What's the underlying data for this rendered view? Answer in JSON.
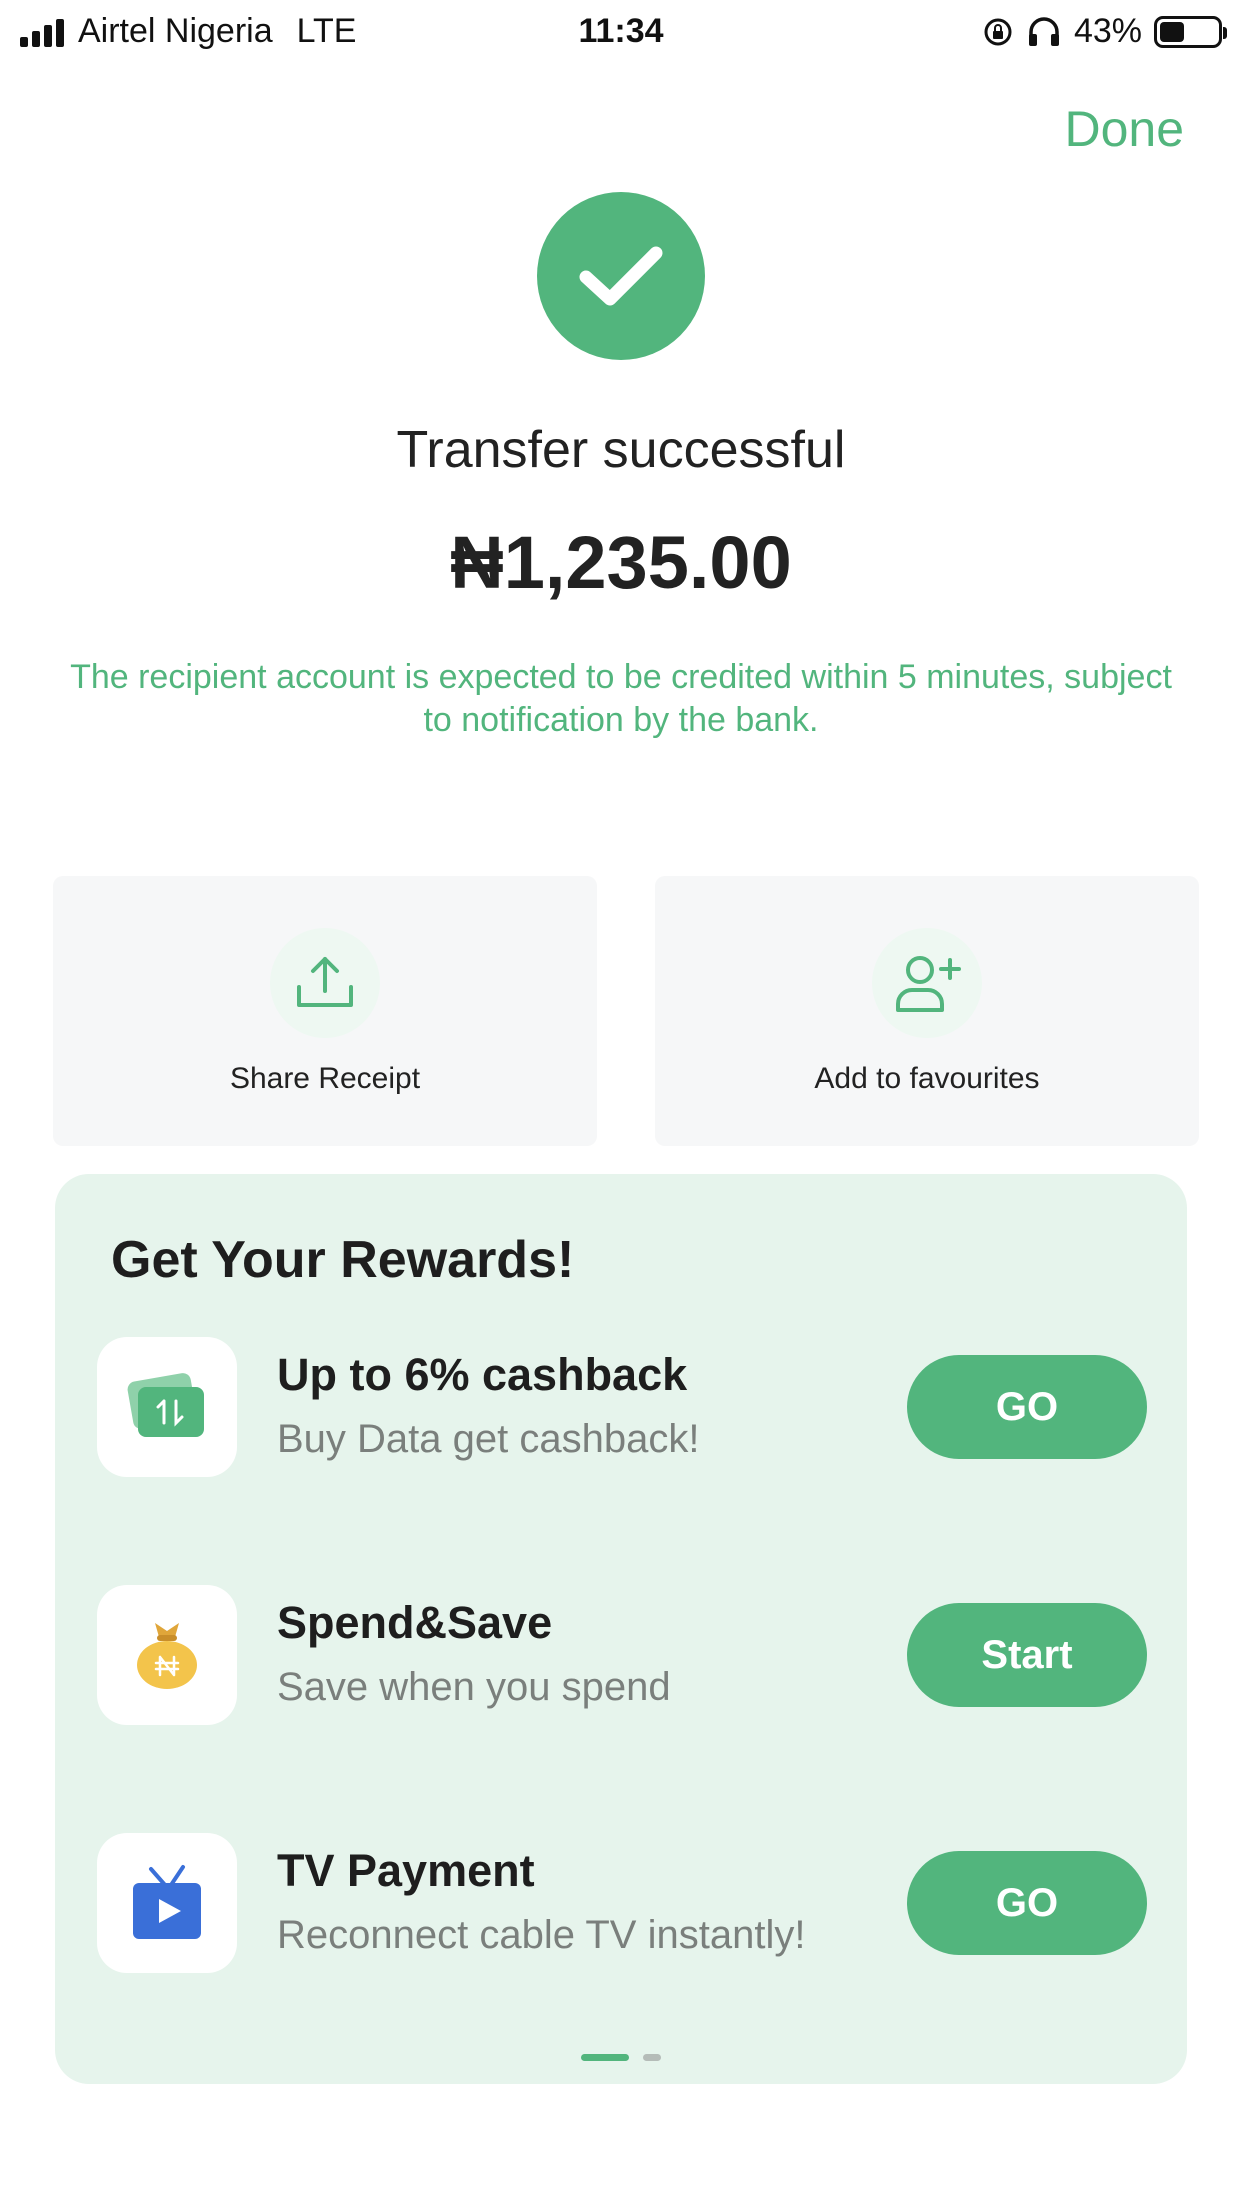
{
  "status_bar": {
    "carrier": "Airtel Nigeria",
    "network": "LTE",
    "time": "11:34",
    "battery": "43%",
    "battery_level": 0.43
  },
  "header": {
    "done_label": "Done"
  },
  "result": {
    "title": "Transfer successful",
    "amount": "₦1,235.00",
    "note": "The recipient account is expected to be credited within 5 minutes, subject to notification by the bank."
  },
  "actions": [
    {
      "label": "Share Receipt",
      "icon": "share-upload-icon"
    },
    {
      "label": "Add to favourites",
      "icon": "add-user-icon"
    }
  ],
  "rewards": {
    "title": "Get Your Rewards!",
    "items": [
      {
        "name": "Up to 6% cashback",
        "desc": "Buy Data get cashback!",
        "button": "GO",
        "icon": "data-card-icon"
      },
      {
        "name": "Spend&Save",
        "desc": "Save when you spend",
        "button": "Start",
        "icon": "money-bag-icon"
      },
      {
        "name": "TV Payment",
        "desc": "Reconnect cable TV instantly!",
        "button": "GO",
        "icon": "tv-play-icon"
      }
    ],
    "page_count": 2,
    "active_page": 1
  },
  "colors": {
    "accent": "#52b57d",
    "rewards_bg": "#e6f4ec",
    "action_bg": "#f6f7f8"
  }
}
